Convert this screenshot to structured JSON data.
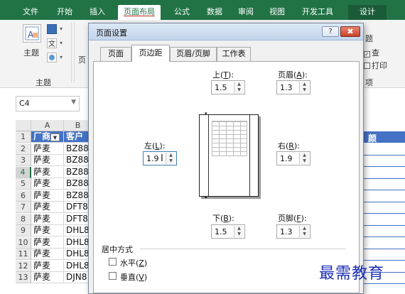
{
  "ribbon": {
    "tabs": [
      "文件",
      "开始",
      "插入",
      "页面布局",
      "公式",
      "数据",
      "审阅",
      "视图",
      "开发工具",
      "设计"
    ],
    "active_tab": "页面布局",
    "theme_label": "主题",
    "theme_group_label": "主题",
    "right_item_1": "题",
    "right_item_2": "查",
    "right_item_3": "打印",
    "right_item_4": "项",
    "page_label_fragment": "页"
  },
  "namebox": {
    "value": "C4"
  },
  "grid": {
    "col_headers": [
      "A",
      "B"
    ],
    "row_numbers": [
      "1",
      "2",
      "3",
      "4",
      "5",
      "6",
      "7",
      "8",
      "9",
      "10",
      "11",
      "12",
      "13"
    ],
    "active_row": "4",
    "col_a_header": "厂商",
    "col_b_header": "客户",
    "col_a_values": [
      "萨麦",
      "萨麦",
      "萨麦",
      "萨麦",
      "萨麦",
      "萨麦",
      "萨麦",
      "萨麦",
      "萨麦",
      "萨麦",
      "萨麦",
      "萨麦"
    ],
    "col_b_values": [
      "BZ88",
      "BZ88",
      "BZ88",
      "BZ88",
      "BZ88",
      "DFT8",
      "DFT8",
      "DHL8",
      "DHL8",
      "DHL8",
      "DHL8",
      "DJN8"
    ],
    "right_col_header": "颜"
  },
  "dialog": {
    "title": "页面设置",
    "help_glyph": "?",
    "close_glyph": "✖",
    "tabs": [
      "页面",
      "页边距",
      "页眉/页脚",
      "工作表"
    ],
    "active_tab": "页边距",
    "top": {
      "label": "上",
      "key": "T",
      "value": "1.5"
    },
    "header": {
      "label": "页眉",
      "key": "A",
      "value": "1.3"
    },
    "left": {
      "label": "左",
      "key": "L",
      "value": "1.9"
    },
    "right": {
      "label": "右",
      "key": "R",
      "value": "1.9"
    },
    "bottom": {
      "label": "下",
      "key": "B",
      "value": "1.5"
    },
    "footer": {
      "label": "页脚",
      "key": "F",
      "value": "1.3"
    },
    "center_title": "居中方式",
    "horizontal": {
      "label": "水平",
      "key": "Z",
      "checked": false
    },
    "vertical": {
      "label": "垂直",
      "key": "V",
      "checked": false
    }
  },
  "watermark": "最需教育"
}
